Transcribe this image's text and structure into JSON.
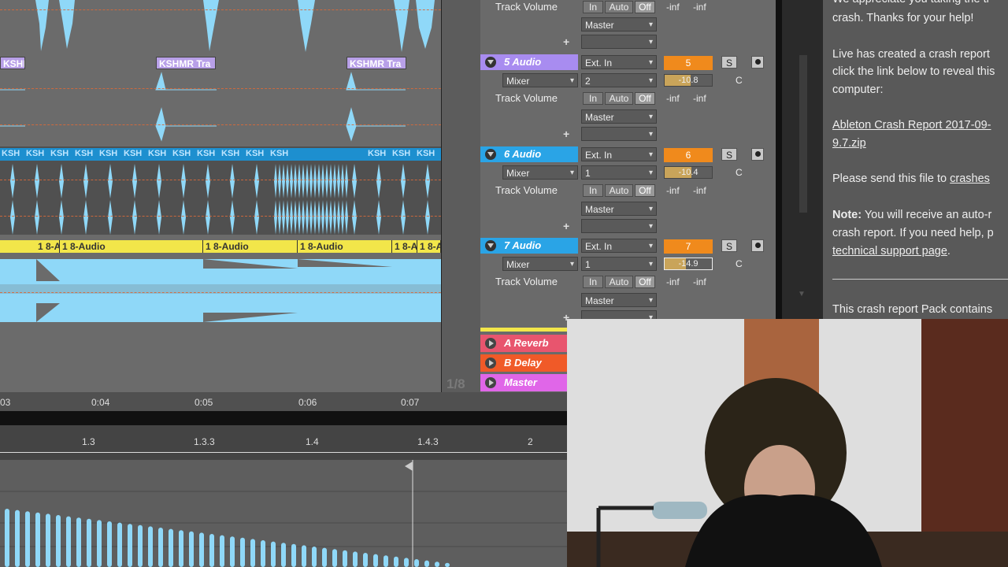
{
  "arrangement": {
    "clips_row2": [
      "KSHMR Tra",
      "KSHMR Tra",
      "KSHMR Tra"
    ],
    "clips_row3_label": "KSH",
    "clips_row4": [
      "1 8-A",
      "1 8-Audio",
      "1 8-Audio",
      "1 8-Audio",
      "1 8-A",
      "1 8-A"
    ],
    "page_indicator": "1/8"
  },
  "mixer": {
    "top_partial": {
      "param": "Track Volume",
      "in": "In",
      "auto": "Auto",
      "off": "Off",
      "inf1": "-inf",
      "inf2": "-inf",
      "route": "Master"
    },
    "tracks": [
      {
        "name": "5 Audio",
        "color": "#a88cf0",
        "input": "Ext. In",
        "mixer": "Mixer",
        "channel": "2",
        "param": "Track Volume",
        "in": "In",
        "auto": "Auto",
        "off": "Off",
        "inf1": "-inf",
        "inf2": "-inf",
        "route": "Master",
        "number": "5",
        "volume": "-10.8",
        "volume_level": 0.55,
        "solo": "S",
        "c": "C"
      },
      {
        "name": "6 Audio",
        "color": "#2aa4e6",
        "input": "Ext. In",
        "mixer": "Mixer",
        "channel": "1",
        "param": "Track Volume",
        "in": "In",
        "auto": "Auto",
        "off": "Off",
        "inf1": "-inf",
        "inf2": "-inf",
        "route": "Master",
        "number": "6",
        "volume": "-10.4",
        "volume_level": 0.57,
        "solo": "S",
        "c": "C"
      },
      {
        "name": "7 Audio",
        "color": "#2aa4e6",
        "input": "Ext. In",
        "mixer": "Mixer",
        "channel": "1",
        "param": "Track Volume",
        "in": "In",
        "auto": "Auto",
        "off": "Off",
        "inf1": "-inf",
        "inf2": "-inf",
        "route": "Master",
        "number": "7",
        "volume": "-14.9",
        "volume_level": 0.45,
        "solo": "S",
        "c": "C"
      }
    ],
    "returns": [
      {
        "name": "A Reverb",
        "color": "#e8556e"
      },
      {
        "name": "B Delay",
        "color": "#f05a28"
      },
      {
        "name": "Master",
        "color": "#e066e8"
      }
    ]
  },
  "report": {
    "line1": "We appreciate you taking the ti",
    "line2": "crash. Thanks for your help!",
    "line3": "Live has created a crash report",
    "line4": "click the link below to reveal this",
    "line5": "computer:",
    "link1": "Ableton Crash Report 2017-09-",
    "link2": "9.7.zip",
    "send_text": "Please send this file to ",
    "send_link": "crashes",
    "note_label": "Note:",
    "note1": " You will receive an auto-r",
    "note2": "crash report. If you need help, p",
    "note_link": "technical support page",
    "note_end": ".",
    "pack_text": "This crash report Pack contains"
  },
  "timeline": {
    "ticks": [
      "03",
      "0:04",
      "0:05",
      "0:06",
      "0:07"
    ],
    "ruler": [
      "1.3",
      "1.3.3",
      "1.4",
      "1.4.3",
      "2"
    ]
  },
  "colors": {
    "waveform": "#8fd8f8",
    "clip_yellow": "#f2e64a",
    "orange": "#f08a1c"
  }
}
